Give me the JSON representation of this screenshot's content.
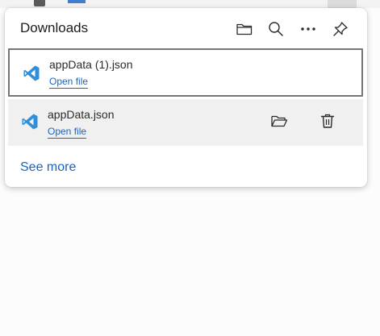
{
  "panel": {
    "title": "Downloads",
    "header_icons": [
      "folder-icon",
      "search-icon",
      "more-options-icon",
      "pin-icon"
    ],
    "see_more_label": "See more"
  },
  "downloads": [
    {
      "filename": "appData (1).json",
      "action_label": "Open file",
      "icon": "vscode-icon",
      "state": "focused"
    },
    {
      "filename": "appData.json",
      "action_label": "Open file",
      "icon": "vscode-icon",
      "state": "hovered",
      "row_icons": [
        "open-folder-icon",
        "trash-icon"
      ]
    }
  ],
  "colors": {
    "link": "#1a63c4",
    "vscode_blue": "#2f8fd8",
    "focus_border": "#757575",
    "hover_bg": "#f0f0f0"
  }
}
